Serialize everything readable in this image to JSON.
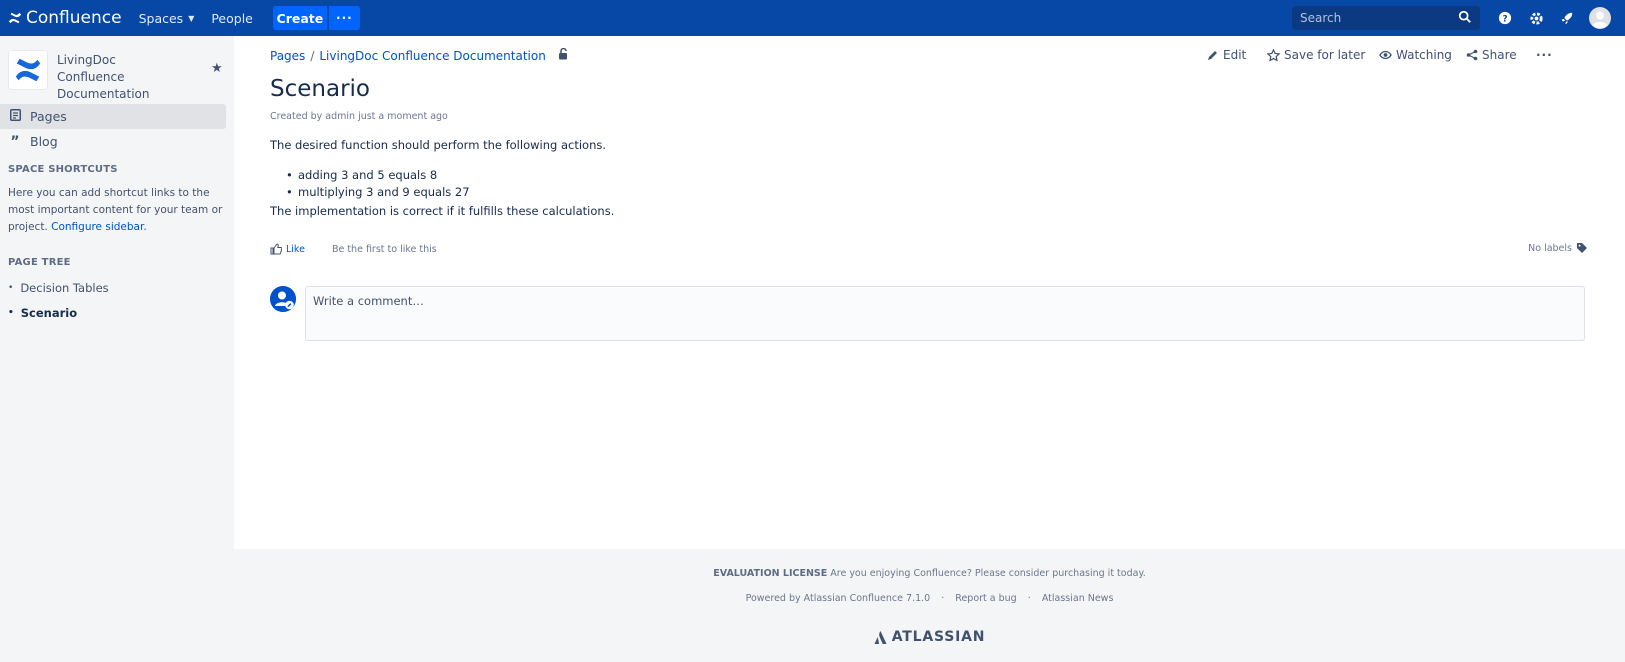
{
  "topbar": {
    "app_name": "Confluence",
    "spaces_label": "Spaces",
    "people_label": "People",
    "create_label": "Create",
    "more_label": "···",
    "search_placeholder": "Search"
  },
  "sidebar": {
    "space_name": "LivingDoc Confluence Documentation",
    "pages_label": "Pages",
    "blog_label": "Blog",
    "shortcuts_heading": "SPACE SHORTCUTS",
    "shortcuts_note": "Here you can add shortcut links to the most important content for your team or project.",
    "configure_link": "Configure sidebar.",
    "tree_heading": "PAGE TREE",
    "tree": [
      {
        "label": "Decision Tables",
        "current": false
      },
      {
        "label": "Scenario",
        "current": true
      }
    ]
  },
  "page": {
    "breadcrumb": [
      "Pages",
      "LivingDoc Confluence Documentation"
    ],
    "actions": {
      "edit": "Edit",
      "save_for_later": "Save for later",
      "watching": "Watching",
      "share": "Share"
    },
    "title": "Scenario",
    "byline": "Created by admin just a moment ago",
    "intro": "The desired function should perform the following actions.",
    "bullets": [
      "adding 3 and 5 equals 8",
      "multiplying 3 and 9 equals 27"
    ],
    "outro": "The implementation is correct if it fulfills these calculations.",
    "like_label": "Like",
    "first_like": "Be the first to like this",
    "labels_text": "No labels",
    "comment_placeholder": "Write a comment…"
  },
  "footer": {
    "eval_bold": "EVALUATION LICENSE",
    "eval_text": " Are you enjoying Confluence? Please consider purchasing it today.",
    "powered_by": "Powered by Atlassian Confluence 7.1.0",
    "report_bug": "Report a bug",
    "atlassian_news": "Atlassian News",
    "brand": "ATLASSIAN"
  },
  "colors": {
    "topbar": "#0747a6",
    "create_button": "#0065ff",
    "link": "#0052cc",
    "sidebar_bg": "#f4f5f7"
  }
}
